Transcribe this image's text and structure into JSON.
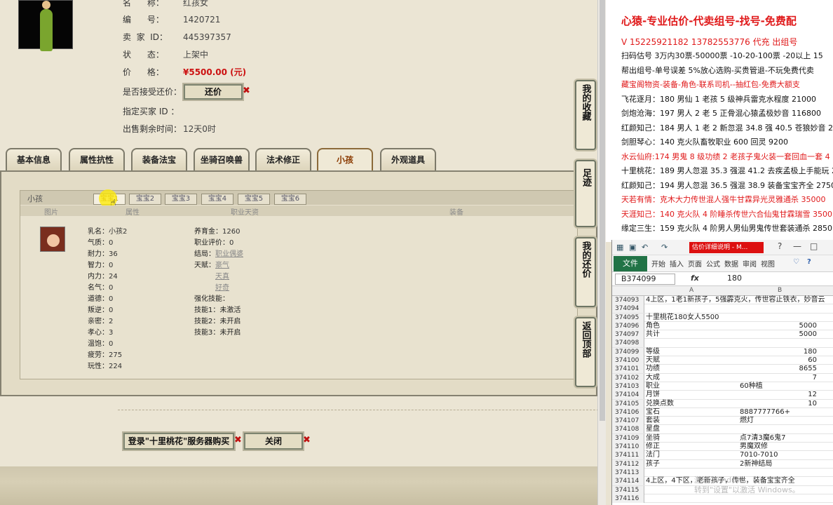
{
  "listing": {
    "name_label": "名      称：",
    "name_value": "红孩女",
    "id_label": "编      号：",
    "id_value": "1420721",
    "seller_label": "卖  家  ID：",
    "seller_value": "445397357",
    "status_label": "状      态：",
    "status_value": "上架中",
    "price_label": "价      格：",
    "price_value": "¥5500.00 (元)",
    "bargain_label": "是否接受还价：",
    "bargain_button": "还价",
    "buyer_label": "指定买家 ID ：",
    "buyer_value": "",
    "time_label": "出售剩余时间：",
    "time_value": "12天0时"
  },
  "tabs": [
    "基本信息",
    "属性抗性",
    "装备法宝",
    "坐骑召唤兽",
    "法术修正",
    "小孩",
    "外观道具"
  ],
  "panel": {
    "title": "小孩",
    "baby_tabs": [
      "宝宝1",
      "宝宝2",
      "宝宝3",
      "宝宝4",
      "宝宝5",
      "宝宝6"
    ],
    "cols": [
      "图片",
      "属性",
      "职业天资",
      "装备"
    ]
  },
  "child": {
    "left_stats": [
      {
        "k": "乳名：",
        "v": "小孩2"
      },
      {
        "k": "气质：",
        "v": "0"
      },
      {
        "k": "耐力：",
        "v": "36"
      },
      {
        "k": "智力：",
        "v": "0"
      },
      {
        "k": "内力：",
        "v": "24"
      },
      {
        "k": "名气：",
        "v": "0"
      },
      {
        "k": "道德：",
        "v": "0"
      },
      {
        "k": "叛逆：",
        "v": "0"
      },
      {
        "k": "亲密：",
        "v": "2"
      },
      {
        "k": "孝心：",
        "v": "3"
      },
      {
        "k": "温饱：",
        "v": "0"
      },
      {
        "k": "疲劳：",
        "v": "275"
      },
      {
        "k": "玩性：",
        "v": "224"
      }
    ],
    "raise_label": "养育金：",
    "raise_value": "1260",
    "job_eval_label": "职业评价：",
    "job_eval_value": "0",
    "ending_label": "结局：",
    "ending_value": "职业偶婆",
    "talent_label": "天赋：",
    "talents": [
      "豪气",
      "天真",
      "好奇"
    ],
    "enhance_label": "强化技能：",
    "skills": [
      "技能1：未激活",
      "技能2：未开启",
      "技能3：未开启"
    ]
  },
  "buttons": {
    "login_buy": "登录\"十里桃花\"服务器购买",
    "close": "关闭"
  },
  "sidebar": {
    "fav": "我的收藏",
    "footprint": "足迹",
    "myoffer": "我的还价",
    "top": "返回顶部"
  },
  "ad": {
    "title": "心猿-专业估价-代卖组号-找号-免费配",
    "phone": "V 15225921182    13782553776 代充  出组号",
    "lines": [
      {
        "t": "扫码估号 3万内30票-50000票  -10-20-100票 -20以上 15",
        "c": "black"
      },
      {
        "t": "帮出组号-单号误差 5%放心选购-买贵管退-不玩免费代卖",
        "c": "black"
      },
      {
        "t": "藏宝阁物资-装备-角色-联系司机--抽红包-免费大额支",
        "c": "red"
      },
      {
        "t": "飞花逐月：180 男仙 1 老孩 5 级神兵雷克水程度 21000",
        "c": "black"
      },
      {
        "t": "剑炮沧海：197 男人 2 老 5 正骨混心猿孟极妙音 116800",
        "c": "black"
      },
      {
        "t": "红颜知己：184 男人 1 老 2 新忽混 34.8 强 40.5 苍狼妙音 229",
        "c": "black"
      },
      {
        "t": "剑胆琴心：140 克火队畜牧职业 600 回灵 9200",
        "c": "black"
      },
      {
        "t": "水云仙府:174 男鬼 8 级功绩 2 老孩子鬼火装一套回血一套 4",
        "c": "red"
      },
      {
        "t": "十里桃花：189 男人忽混 35.3 强混 41.2 去疾孟极上手能玩 2",
        "c": "black"
      },
      {
        "t": "红颜知己：194 男人忽混 36.5 强混 38.9 装备宝宝齐全 27500",
        "c": "black"
      },
      {
        "t": "天若有情：克木大力传世混人强牛甘霖异光灵雅通杀 35000",
        "c": "red"
      },
      {
        "t": "天涯知己：140 克火队 4 阶睡杀传世六合仙鬼甘霖瑞雪 3500",
        "c": "red"
      },
      {
        "t": "缘定三生：159 克火队 4 阶男人男仙男鬼传世套装通杀 2850",
        "c": "black"
      }
    ]
  },
  "excel": {
    "doc_title": "估价详细说明 - M...",
    "file_tab": "文件",
    "ribbon_tabs": [
      "开始",
      "插入",
      "页面",
      "公式",
      "数据",
      "审阅",
      "视图"
    ],
    "name_box": "B374099",
    "fx": "fx",
    "formula_value": "180",
    "col_a": "A",
    "col_b": "B",
    "rows": [
      {
        "n": "374093",
        "a": "4上区，1老1新孩子，5强霹克火，传世容止铁衣，妙音云",
        "b": "",
        "num": false
      },
      {
        "n": "374094",
        "a": "",
        "b": "",
        "num": false
      },
      {
        "n": "374095",
        "a": "十里桃花180女人5500",
        "b": "",
        "num": false
      },
      {
        "n": "374096",
        "a": "角色",
        "b": "5000",
        "num": true
      },
      {
        "n": "374097",
        "a": "共计",
        "b": "5000",
        "num": true
      },
      {
        "n": "374098",
        "a": "",
        "b": "",
        "num": false
      },
      {
        "n": "374099",
        "a": "等级",
        "b": "180",
        "num": true
      },
      {
        "n": "374100",
        "a": "天赋",
        "b": "60",
        "num": true
      },
      {
        "n": "374101",
        "a": "功绩",
        "b": "8655",
        "num": true
      },
      {
        "n": "374102",
        "a": "大成",
        "b": "7",
        "num": true
      },
      {
        "n": "374103",
        "a": "职业",
        "b": "60种植",
        "num": false
      },
      {
        "n": "374104",
        "a": "月饼",
        "b": "12",
        "num": true
      },
      {
        "n": "374105",
        "a": "兑换点数",
        "b": "10",
        "num": true
      },
      {
        "n": "374106",
        "a": "宝石",
        "b": "8887777766+",
        "num": false
      },
      {
        "n": "374107",
        "a": "套装",
        "b": "燃灯",
        "num": false
      },
      {
        "n": "374108",
        "a": "星盘",
        "b": "",
        "num": false
      },
      {
        "n": "374109",
        "a": "坐骑",
        "b": "点7清3魔6鬼7",
        "num": false
      },
      {
        "n": "374110",
        "a": "修正",
        "b": "男魔双修",
        "num": false
      },
      {
        "n": "374111",
        "a": "法门",
        "b": "7010-7010",
        "num": false
      },
      {
        "n": "374112",
        "a": "孩子",
        "b": "2新神结局",
        "num": false
      },
      {
        "n": "374113",
        "a": "",
        "b": "",
        "num": false
      },
      {
        "n": "374114",
        "a": "4上区，4下区，老新孩子，传世，装备宝宝齐全",
        "b": "",
        "num": false
      },
      {
        "n": "374115",
        "a": "",
        "b": "",
        "num": false
      },
      {
        "n": "374116",
        "a": "",
        "b": "",
        "num": false
      }
    ]
  },
  "watermark": {
    "l1": "激活 Windows",
    "l2": "转到\"设置\"以激活 Windows。"
  }
}
